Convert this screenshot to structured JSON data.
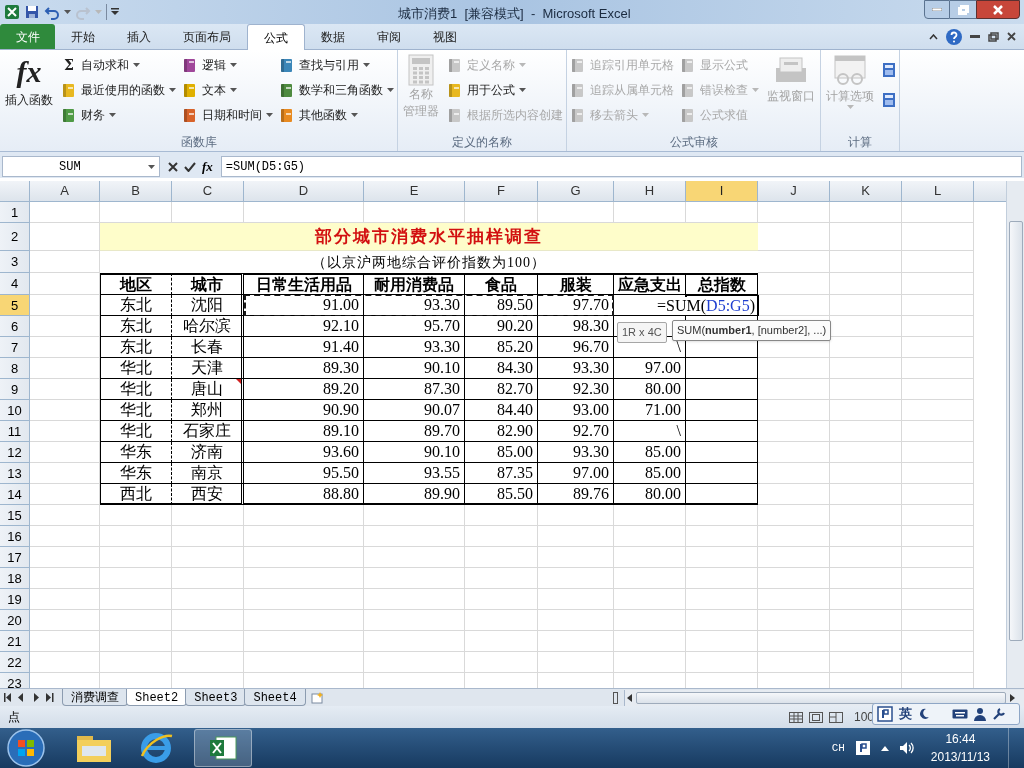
{
  "window": {
    "title": "城市消费1  [兼容模式]  -  Microsoft Excel"
  },
  "ribbon_tabs": [
    {
      "label": "文件",
      "kind": "file",
      "selected": false
    },
    {
      "label": "开始",
      "kind": "tab",
      "selected": false
    },
    {
      "label": "插入",
      "kind": "tab",
      "selected": false
    },
    {
      "label": "页面布局",
      "kind": "tab",
      "selected": false
    },
    {
      "label": "公式",
      "kind": "tab",
      "selected": true
    },
    {
      "label": "数据",
      "kind": "tab",
      "selected": false
    },
    {
      "label": "审阅",
      "kind": "tab",
      "selected": false
    },
    {
      "label": "视图",
      "kind": "tab",
      "selected": false
    }
  ],
  "ribbon_groups": [
    {
      "title": "函数库",
      "items": [
        {
          "kind": "large",
          "label": "插入函数",
          "glyph": "fx",
          "disabled": false,
          "dropdown": false
        },
        {
          "kind": "column",
          "items": [
            {
              "label": "自动求和",
              "glyph": "Σ",
              "disabled": false,
              "dropdown": true
            },
            {
              "label": "最近使用的函数",
              "disabled": false,
              "dropdown": true
            },
            {
              "label": "财务",
              "disabled": false,
              "dropdown": true
            }
          ]
        },
        {
          "kind": "column",
          "items": [
            {
              "label": "逻辑",
              "disabled": false,
              "dropdown": true
            },
            {
              "label": "文本",
              "disabled": false,
              "dropdown": true
            },
            {
              "label": "日期和时间",
              "disabled": false,
              "dropdown": true
            }
          ]
        },
        {
          "kind": "column",
          "items": [
            {
              "label": "查找与引用",
              "disabled": false,
              "dropdown": true
            },
            {
              "label": "数学和三角函数",
              "disabled": false,
              "dropdown": true
            },
            {
              "label": "其他函数",
              "disabled": false,
              "dropdown": true
            }
          ]
        }
      ]
    },
    {
      "title": "定义的名称",
      "items": [
        {
          "kind": "large",
          "label_lines": [
            "名称",
            "管理器"
          ],
          "disabled": true,
          "dropdown": false
        },
        {
          "kind": "column",
          "items": [
            {
              "label": "定义名称",
              "disabled": true,
              "dropdown": true
            },
            {
              "label": "用于公式",
              "disabled": false,
              "dropdown": true
            },
            {
              "label": "根据所选内容创建",
              "disabled": true,
              "dropdown": false
            }
          ]
        }
      ]
    },
    {
      "title": "公式审核",
      "items": [
        {
          "kind": "column",
          "items": [
            {
              "label": "追踪引用单元格",
              "disabled": true,
              "dropdown": false
            },
            {
              "label": "追踪从属单元格",
              "disabled": true,
              "dropdown": false
            },
            {
              "label": "移去箭头",
              "disabled": true,
              "dropdown": true
            }
          ]
        },
        {
          "kind": "column",
          "items": [
            {
              "label": "显示公式",
              "disabled": true,
              "dropdown": false
            },
            {
              "label": "错误检查",
              "disabled": true,
              "dropdown": true
            },
            {
              "label": "公式求值",
              "disabled": true,
              "dropdown": false
            }
          ]
        },
        {
          "kind": "large",
          "label": "监视窗口",
          "disabled": true,
          "dropdown": false
        }
      ]
    },
    {
      "title": "计算",
      "items": [
        {
          "kind": "large",
          "label": "计算选项",
          "disabled": true,
          "dropdown": true
        },
        {
          "kind": "icons"
        }
      ]
    }
  ],
  "formula_bar": {
    "name_box": "SUM",
    "fx": "fx",
    "formula": "=SUM(D5:G5)"
  },
  "columns": [
    {
      "label": "A",
      "selected": false
    },
    {
      "label": "B",
      "selected": false
    },
    {
      "label": "C",
      "selected": false
    },
    {
      "label": "D",
      "selected": false
    },
    {
      "label": "E",
      "selected": false
    },
    {
      "label": "F",
      "selected": false
    },
    {
      "label": "G",
      "selected": false
    },
    {
      "label": "H",
      "selected": false
    },
    {
      "label": "I",
      "selected": true
    },
    {
      "label": "J",
      "selected": false
    },
    {
      "label": "K",
      "selected": false
    },
    {
      "label": "L",
      "selected": false
    }
  ],
  "row_headers": [
    {
      "label": "1",
      "selected": false
    },
    {
      "label": "2",
      "selected": false
    },
    {
      "label": "3",
      "selected": false
    },
    {
      "label": "4",
      "selected": false
    },
    {
      "label": "5",
      "selected": true
    },
    {
      "label": "6",
      "selected": false
    },
    {
      "label": "7",
      "selected": false
    },
    {
      "label": "8",
      "selected": false
    },
    {
      "label": "9",
      "selected": false
    },
    {
      "label": "10",
      "selected": false
    },
    {
      "label": "11",
      "selected": false
    },
    {
      "label": "12",
      "selected": false
    },
    {
      "label": "13",
      "selected": false
    },
    {
      "label": "14",
      "selected": false
    },
    {
      "label": "15",
      "selected": false
    },
    {
      "label": "16",
      "selected": false
    },
    {
      "label": "17",
      "selected": false
    },
    {
      "label": "18",
      "selected": false
    },
    {
      "label": "19",
      "selected": false
    },
    {
      "label": "20",
      "selected": false
    },
    {
      "label": "21",
      "selected": false
    },
    {
      "label": "22",
      "selected": false
    },
    {
      "label": "23",
      "selected": false
    }
  ],
  "sheet": {
    "title": "部分城市消费水平抽样调查",
    "subtitle": "（以京沪两地综合评价指数为100）",
    "header": [
      "地区",
      "城市",
      "日常生活用品",
      "耐用消费品",
      "食品",
      "服装",
      "应急支出",
      "总指数"
    ],
    "rows": [
      {
        "region": "东北",
        "city": "沈阳",
        "values": [
          "91.00",
          "93.30",
          "89.50",
          "97.70"
        ],
        "referenced": true,
        "comment": false,
        "editing": [
          {
            "text": "=SUM(",
            "kind": "plain"
          },
          {
            "text": "D5:G5",
            "kind": "ref"
          },
          {
            "text": ")",
            "kind": "plain"
          }
        ]
      },
      {
        "region": "东北",
        "city": "哈尔滨",
        "values": [
          "92.10",
          "95.70",
          "90.20",
          "98.30"
        ],
        "referenced": false,
        "comment": false
      },
      {
        "region": "东北",
        "city": "长春",
        "values": [
          "91.40",
          "93.30",
          "85.20",
          "96.70"
        ],
        "referenced": false,
        "comment": false,
        "h": "\\"
      },
      {
        "region": "华北",
        "city": "天津",
        "values": [
          "89.30",
          "90.10",
          "84.30",
          "93.30"
        ],
        "referenced": false,
        "comment": false,
        "h": "97.00"
      },
      {
        "region": "华北",
        "city": "唐山",
        "values": [
          "89.20",
          "87.30",
          "82.70",
          "92.30"
        ],
        "referenced": false,
        "comment": true,
        "h": "80.00"
      },
      {
        "region": "华北",
        "city": "郑州",
        "values": [
          "90.90",
          "90.07",
          "84.40",
          "93.00"
        ],
        "referenced": false,
        "comment": false,
        "h": "71.00"
      },
      {
        "region": "华北",
        "city": "石家庄",
        "values": [
          "89.10",
          "89.70",
          "82.90",
          "92.70"
        ],
        "referenced": false,
        "comment": false,
        "h": "\\"
      },
      {
        "region": "华东",
        "city": "济南",
        "values": [
          "93.60",
          "90.10",
          "85.00",
          "93.30"
        ],
        "referenced": false,
        "comment": false,
        "h": "85.00"
      },
      {
        "region": "华东",
        "city": "南京",
        "values": [
          "95.50",
          "93.55",
          "87.35",
          "97.00"
        ],
        "referenced": false,
        "comment": false,
        "h": "85.00"
      },
      {
        "region": "西北",
        "city": "西安",
        "values": [
          "88.80",
          "89.90",
          "85.50",
          "89.76"
        ],
        "referenced": false,
        "comment": false,
        "h": "80.00"
      }
    ]
  },
  "tooltips": {
    "size": "1R x 4C",
    "syntax": "SUM(**number1**, [number2], ...)"
  },
  "sheet_tabs": [
    {
      "label": "消费调查",
      "selected": false
    },
    {
      "label": "Sheet2",
      "selected": true
    },
    {
      "label": "Sheet3",
      "selected": false
    },
    {
      "label": "Sheet4",
      "selected": false
    }
  ],
  "status_bar": {
    "mode": "点",
    "zoom": "100"
  },
  "ime_bar": {
    "language": "英"
  },
  "taskbar": {
    "input_language": "CH",
    "time": "16:44",
    "date": "2013/11/13"
  }
}
